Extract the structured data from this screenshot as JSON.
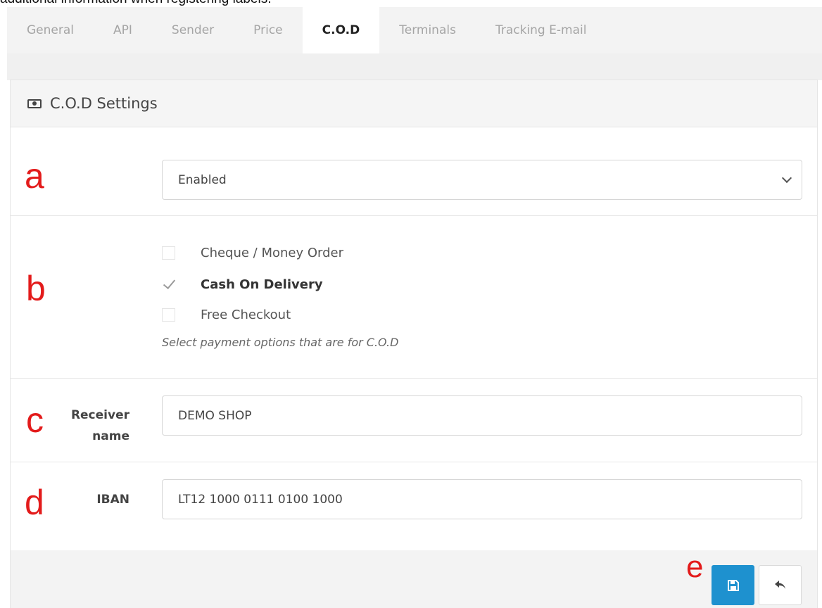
{
  "caption": "additional information when registering labels.",
  "tabs": [
    {
      "label": "General",
      "active": false
    },
    {
      "label": "API",
      "active": false
    },
    {
      "label": "Sender",
      "active": false
    },
    {
      "label": "Price",
      "active": false
    },
    {
      "label": "C.O.D",
      "active": true
    },
    {
      "label": "Terminals",
      "active": false
    },
    {
      "label": "Tracking E-mail",
      "active": false
    }
  ],
  "panel": {
    "title": "C.O.D Settings",
    "icon": "money-icon"
  },
  "markers": {
    "a": "a",
    "b": "b",
    "c": "c",
    "d": "d",
    "e": "e"
  },
  "status_select": {
    "value": "Enabled"
  },
  "payment_options": {
    "items": [
      {
        "label": "Cheque / Money Order",
        "checked": false
      },
      {
        "label": "Cash On Delivery",
        "checked": true
      },
      {
        "label": "Free Checkout",
        "checked": false
      }
    ],
    "help": "Select payment options that are for C.O.D"
  },
  "receiver": {
    "label_line1": "Receiver",
    "label_line2": "name",
    "value": "DEMO SHOP"
  },
  "iban": {
    "label": "IBAN",
    "value": "LT12 1000 0111 0100 1000"
  },
  "buttons": {
    "save_icon": "save-icon",
    "back_icon": "reply-icon"
  },
  "colors": {
    "primary": "#1e91cf",
    "marker": "#e31b1b",
    "active_tab_text": "#222222"
  }
}
